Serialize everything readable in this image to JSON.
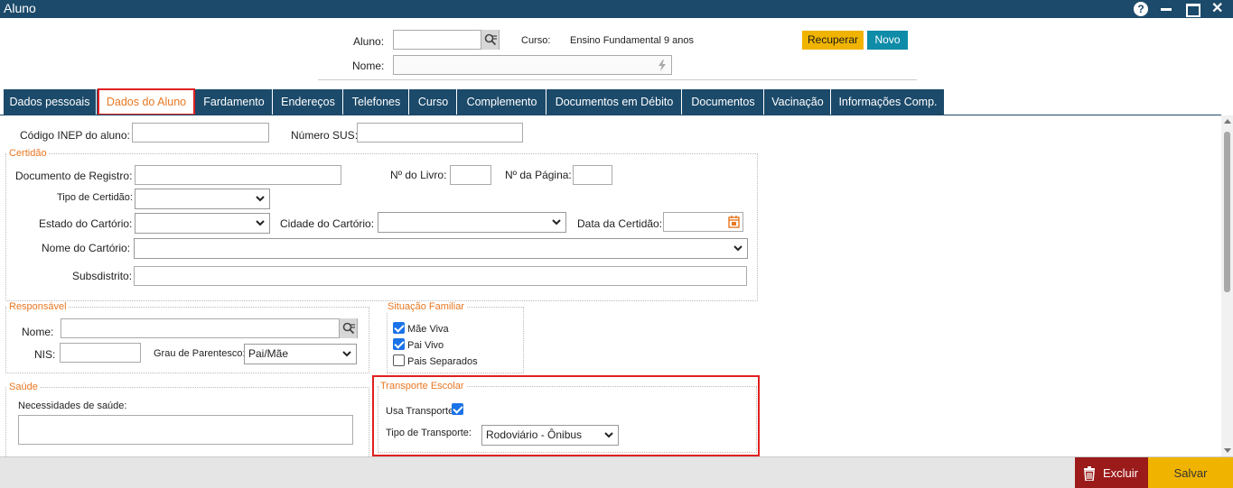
{
  "window": {
    "title": "Aluno",
    "help_label": "?"
  },
  "header": {
    "aluno_label": "Aluno:",
    "aluno_value": "",
    "curso_label": "Curso:",
    "curso_value": "Ensino Fundamental 9 anos",
    "nome_label": "Nome:",
    "nome_value": "",
    "recuperar_label": "Recuperar",
    "novo_label": "Novo"
  },
  "tabs": [
    {
      "label": "Dados pessoais",
      "active": false
    },
    {
      "label": "Dados do Aluno",
      "active": true
    },
    {
      "label": "Fardamento",
      "active": false
    },
    {
      "label": "Endereços",
      "active": false
    },
    {
      "label": "Telefones",
      "active": false
    },
    {
      "label": "Curso",
      "active": false
    },
    {
      "label": "Complemento",
      "active": false
    },
    {
      "label": "Documentos em Débito",
      "active": false
    },
    {
      "label": "Documentos",
      "active": false
    },
    {
      "label": "Vacinação",
      "active": false
    },
    {
      "label": "Informações Comp.",
      "active": false
    }
  ],
  "form": {
    "inep_label": "Código INEP do aluno:",
    "sus_label": "Número SUS:",
    "certidao": {
      "legend": "Certidão",
      "doc_registro_label": "Documento de Registro:",
      "livro_label": "Nº do Livro:",
      "pagina_label": "Nº da Página:",
      "tipo_label": "Tipo de Certidão:",
      "estado_label": "Estado do Cartório:",
      "cidade_label": "Cidade do Cartório:",
      "data_label": "Data da Certidão:",
      "nome_cartorio_label": "Nome do Cartório:",
      "subdistrito_label": "Subsdistrito:"
    },
    "responsavel": {
      "legend": "Responsável",
      "nome_label": "Nome:",
      "nis_label": "NIS:",
      "grau_label": "Grau de Parentesco:",
      "grau_value": "Pai/Mãe"
    },
    "situacao": {
      "legend": "Situação Familiar",
      "mae_viva_label": "Mãe Viva",
      "mae_viva": true,
      "pai_vivo_label": "Pai Vivo",
      "pai_vivo": true,
      "pais_separados_label": "Pais Separados",
      "pais_separados": false
    },
    "saude": {
      "legend": "Saúde",
      "necessidades_label": "Necessidades de saúde:"
    },
    "transporte": {
      "legend": "Transporte Escolar",
      "usa_label": "Usa Transporte",
      "usa": true,
      "tipo_label": "Tipo de Transporte:",
      "tipo_value": "Rodoviário - Ônibus"
    }
  },
  "footer": {
    "excluir_label": "Excluir",
    "salvar_label": "Salvar"
  },
  "colors": {
    "navy": "#1c4a6a",
    "orange": "#e87722",
    "yellow": "#f0b400",
    "teal": "#0e8ca8",
    "danger": "#9b1b1b",
    "highlight": "#e02020"
  }
}
